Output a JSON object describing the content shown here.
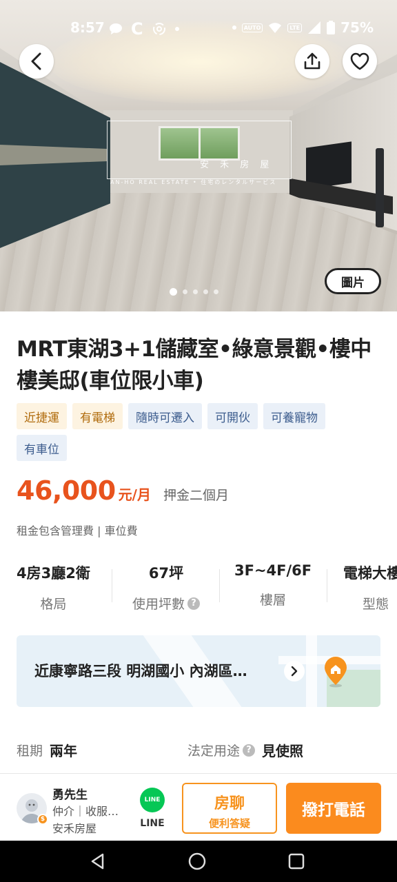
{
  "status_bar": {
    "time": "8:57",
    "carrier_letter": "C",
    "badge_auto": "AUTO",
    "badge_lte": "LTE",
    "battery": "75%"
  },
  "hero": {
    "watermark_name": "安 禾 房 屋",
    "watermark_sub": "AN-HO REAL ESTATE • 住宅のレンタルサービス",
    "photo_button": "圖片",
    "slides": 5,
    "active_slide": 1
  },
  "listing": {
    "title": "MRT東湖3+1儲藏室•綠意景觀•樓中樓美邸(車位限小車)",
    "tags": [
      {
        "label": "近捷運",
        "style": "warm"
      },
      {
        "label": "有電梯",
        "style": "warm"
      },
      {
        "label": "隨時可遷入",
        "style": "cool"
      },
      {
        "label": "可開伙",
        "style": "cool"
      },
      {
        "label": "可養寵物",
        "style": "cool"
      },
      {
        "label": "有車位",
        "style": "cool"
      }
    ],
    "price": "46,000",
    "price_unit": "元/月",
    "deposit": "押金二個月",
    "fee_note": "租金包含管理費 | 車位費"
  },
  "specs": [
    {
      "value": "4房3廳2衛",
      "label": "格局"
    },
    {
      "value": "67坪",
      "label": "使用坪數"
    },
    {
      "value": "3F~4F/6F",
      "label": "樓層"
    },
    {
      "value": "電梯大樓",
      "label": "型態"
    }
  ],
  "location": {
    "address": "近康寧路三段 明湖國小 內湖區…"
  },
  "details": [
    {
      "label": "租期",
      "value": "兩年"
    },
    {
      "label": "法定用途",
      "value": "見使照"
    }
  ],
  "agent": {
    "name": "勇先生",
    "role": "仲介｜收服…",
    "company": "安禾房屋",
    "line_label": "LINE",
    "chat_title": "房聊",
    "chat_sub": "便利答疑",
    "call_label": "撥打電話"
  },
  "colors": {
    "accent": "#f7931e",
    "price": "#e8531d",
    "line": "#06c755"
  }
}
